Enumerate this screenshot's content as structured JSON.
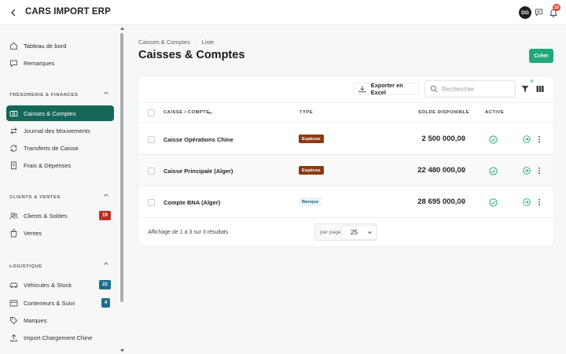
{
  "header": {
    "title": "CARS IMPORT ERP",
    "avatar_initials": "DG",
    "notifications_count": "19"
  },
  "sidebar": {
    "top_items": [
      {
        "label": "Tableau de bord",
        "icon": "home-icon"
      },
      {
        "label": "Remarques",
        "icon": "chat-icon"
      }
    ],
    "sections": [
      {
        "title": "TRÉSORERIE & FINANCES",
        "items": [
          {
            "label": "Caisses & Comptes",
            "icon": "cash-icon",
            "active": true
          },
          {
            "label": "Journal des Mouvements",
            "icon": "swap-icon"
          },
          {
            "label": "Transferts de Caisse",
            "icon": "transfer-icon"
          },
          {
            "label": "Frais & Dépenses",
            "icon": "receipt-icon"
          }
        ]
      },
      {
        "title": "CLIENTS & VENTES",
        "items": [
          {
            "label": "Clients & Soldes",
            "icon": "users-icon",
            "badge": "19",
            "badge_color": "#b8322a"
          },
          {
            "label": "Ventes",
            "icon": "bag-icon"
          }
        ]
      },
      {
        "title": "LOGISTIQUE",
        "items": [
          {
            "label": "Véhicules & Stock",
            "icon": "car-icon",
            "badge": "22",
            "badge_color": "#1f6b8c"
          },
          {
            "label": "Conteneurs & Suivi",
            "icon": "container-icon",
            "badge": "4",
            "badge_color": "#1f6b8c"
          },
          {
            "label": "Marques",
            "icon": "tag-icon"
          },
          {
            "label": "Import Chargement Chine",
            "icon": "upload-icon"
          }
        ]
      }
    ]
  },
  "breadcrumb": {
    "parent": "Caisses & Comptes",
    "separator": "·",
    "current": "Liste"
  },
  "page": {
    "title": "Caisses & Comptes",
    "create_label": "Créer"
  },
  "toolbar": {
    "export_label": "Exporter en Excel",
    "search_placeholder": "Rechercher",
    "filter_count": "0"
  },
  "table": {
    "headers": {
      "name": "CAISSE / COMPTE",
      "type": "TYPE",
      "balance": "SOLDE DISPONIBLE",
      "active": "ACTIVE"
    },
    "rows": [
      {
        "name": "Caisse Opérations Chine",
        "type": "Espèces",
        "type_kind": "especes",
        "balance": "2 500 000,00",
        "currency": "DA",
        "active": true
      },
      {
        "name": "Caisse Principale (Alger)",
        "type": "Espèces",
        "type_kind": "especes",
        "balance": "22 480 000,00",
        "currency": "DA",
        "active": true
      },
      {
        "name": "Compte BNA (Alger)",
        "type": "Banque",
        "type_kind": "banque",
        "balance": "28 695 000,00",
        "currency": "DA",
        "active": true
      }
    ]
  },
  "footer": {
    "info": "Affichage de 1 à 3 sur 3 résultats",
    "per_page_label": "par page",
    "per_page_value": "25"
  },
  "colors": {
    "accent": "#14685a",
    "create": "#22a87d",
    "especes": "#8a3a10",
    "banque_text": "#2a6a8e",
    "active_check": "#22a87d",
    "danger_badge": "#b8322a",
    "info_badge": "#1f6b8c"
  }
}
